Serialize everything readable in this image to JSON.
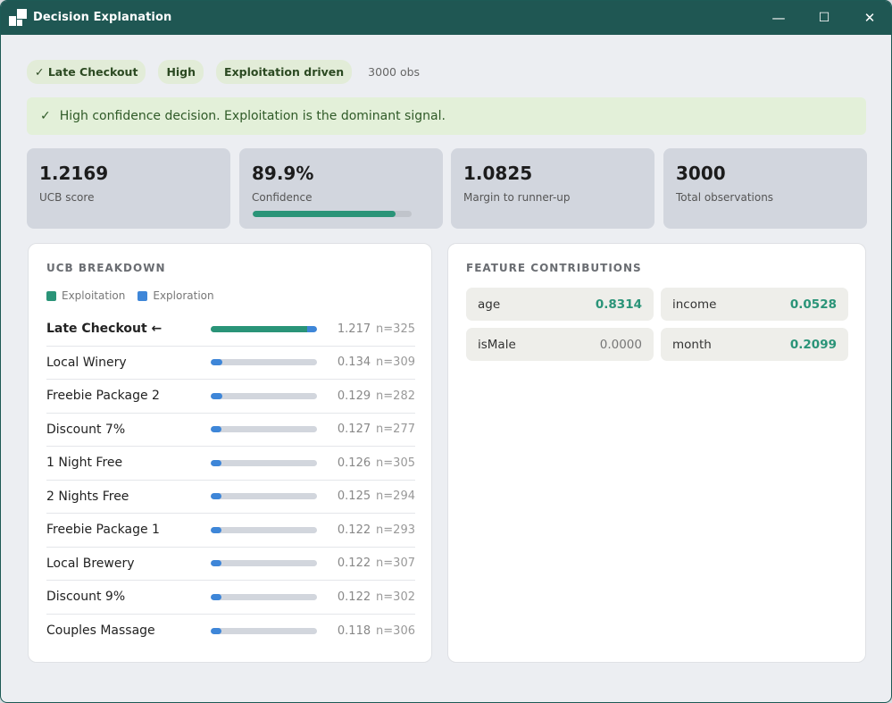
{
  "window": {
    "title": "Decision Explanation",
    "minimize": "—",
    "maximize": "☐",
    "close": "✕"
  },
  "chips": [
    {
      "label": "✓ Late Checkout"
    },
    {
      "label": "High"
    },
    {
      "label": "Exploitation driven"
    },
    {
      "label": "3000 obs"
    }
  ],
  "banner": {
    "check": "✓",
    "text": "High confidence decision. Exploitation is the dominant signal."
  },
  "stats": [
    {
      "value": "1.2169",
      "label": "UCB score"
    },
    {
      "value": "89.9%",
      "label": "Confidence",
      "progress": 0.899
    },
    {
      "value": "1.0825",
      "label": "Margin to runner-up"
    },
    {
      "value": "3000",
      "label": "Total observations"
    }
  ],
  "colors": {
    "exploitation": "#2a9478",
    "exploration": "#3e86d8",
    "track": "#d2d6dd"
  },
  "ucb": {
    "title": "UCB BREAKDOWN",
    "legend": {
      "exploitation": "Exploitation",
      "exploration": "Exploration"
    },
    "rows": [
      {
        "name": "Late Checkout ←",
        "score": "1.217",
        "n": "n=325",
        "exploit": 0.904,
        "explore": 0.096
      },
      {
        "name": "Local Winery",
        "score": "0.134",
        "n": "n=309",
        "exploit": 0.0,
        "explore": 0.11
      },
      {
        "name": "Freebie Package 2",
        "score": "0.129",
        "n": "n=282",
        "exploit": 0.0,
        "explore": 0.11
      },
      {
        "name": "Discount 7%",
        "score": "0.127",
        "n": "n=277",
        "exploit": 0.0,
        "explore": 0.1
      },
      {
        "name": "1 Night Free",
        "score": "0.126",
        "n": "n=305",
        "exploit": 0.0,
        "explore": 0.1
      },
      {
        "name": "2 Nights Free",
        "score": "0.125",
        "n": "n=294",
        "exploit": 0.0,
        "explore": 0.1
      },
      {
        "name": "Freebie Package 1",
        "score": "0.122",
        "n": "n=293",
        "exploit": 0.0,
        "explore": 0.1
      },
      {
        "name": "Local Brewery",
        "score": "0.122",
        "n": "n=307",
        "exploit": 0.0,
        "explore": 0.1
      },
      {
        "name": "Discount 9%",
        "score": "0.122",
        "n": "n=302",
        "exploit": 0.0,
        "explore": 0.1
      },
      {
        "name": "Couples Massage",
        "score": "0.118",
        "n": "n=306",
        "exploit": 0.0,
        "explore": 0.1
      }
    ]
  },
  "features": {
    "title": "FEATURE CONTRIBUTIONS",
    "items": [
      {
        "name": "age",
        "value": "0.8314"
      },
      {
        "name": "income",
        "value": "0.0528"
      },
      {
        "name": "isMale",
        "value": "0.0000"
      },
      {
        "name": "month",
        "value": "0.2099"
      }
    ]
  }
}
